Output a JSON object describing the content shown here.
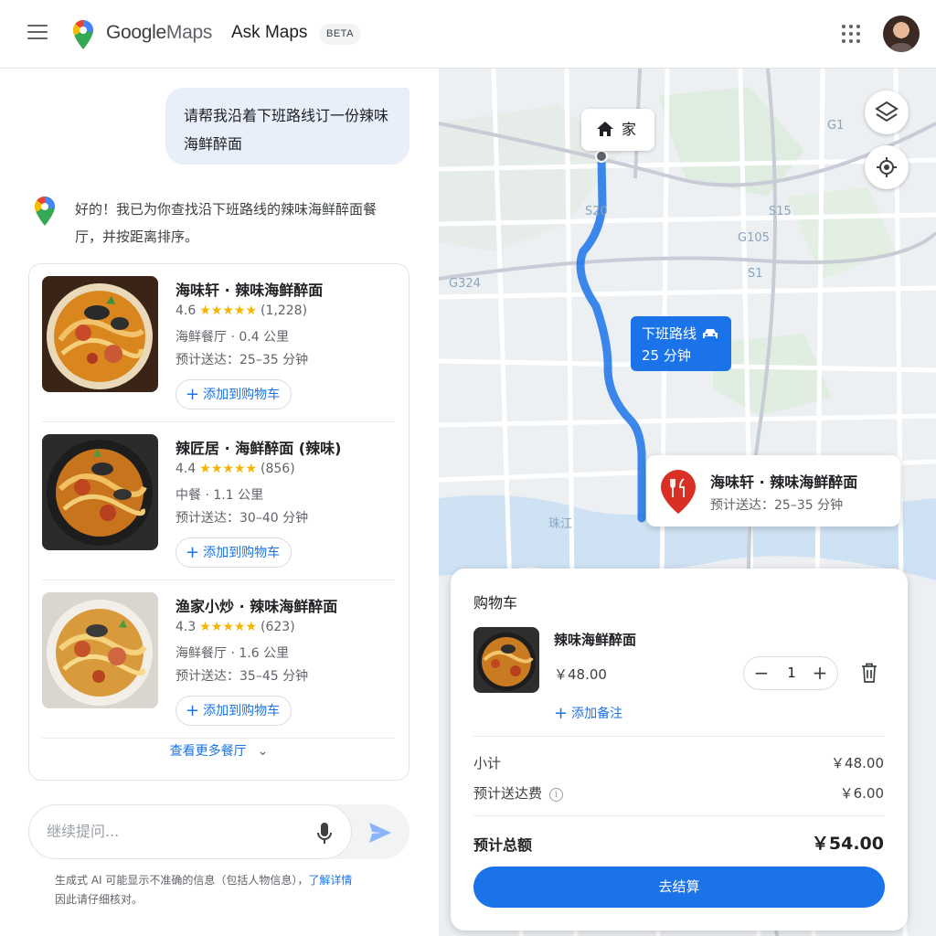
{
  "header": {
    "logo_google": "Google",
    "logo_maps": "Maps",
    "title": "Ask Maps",
    "badge": "BETA"
  },
  "chat": {
    "user_message": "请帮我沿着下班路线订一份辣味海鲜醉面",
    "ai_message": "好的！我已为你查找沿下班路线的辣味海鲜醉面餐厅，并按距离排序。"
  },
  "results": [
    {
      "name": "海味轩 · 辣味海鲜醉面",
      "rating": "4.6",
      "stars": 4.6,
      "reviews": "(1,228)",
      "meta": "海鲜餐厅 · 0.4 公里",
      "eta": "预计送达：25–35 分钟",
      "add_label": "添加到购物车"
    },
    {
      "name": "辣匠居 · 海鲜醉面 (辣味)",
      "rating": "4.4",
      "stars": 4.4,
      "reviews": "(856)",
      "meta": "中餐 · 1.1 公里",
      "eta": "预计送达：30–40 分钟",
      "add_label": "添加到购物车"
    },
    {
      "name": "渔家小炒 · 辣味海鲜醉面",
      "rating": "4.3",
      "stars": 4.3,
      "reviews": "(623)",
      "meta": "海鲜餐厅 · 1.6 公里",
      "eta": "预计送达：35–45 分钟",
      "add_label": "添加到购物车"
    }
  ],
  "more_label": "查看更多餐厅",
  "input": {
    "placeholder": "继续提问..."
  },
  "disclaimer": {
    "text": "生成式 AI 可能显示不准确的信息（包括人物信息），",
    "link": "了解详情",
    "text2": "因此请仔细核对。"
  },
  "map": {
    "home_label": "家",
    "route_label": "下班路线",
    "route_time": "25 分钟",
    "dest_name": "海味轩 · 辣味海鲜醉面",
    "dest_eta": "预计送达：25–35 分钟",
    "road_labels": [
      "S20",
      "S15",
      "G105",
      "G324",
      "S1",
      "G1",
      "珠江"
    ]
  },
  "cart": {
    "title": "购物车",
    "item_name": "辣味海鲜醉面",
    "item_price": "￥48.00",
    "quantity": "1",
    "add_note": "添加备注",
    "subtotal_label": "小计",
    "subtotal_value": "￥48.00",
    "delivery_label": "预计送达费",
    "delivery_value": "￥6.00",
    "total_label": "预计总额",
    "total_value": "￥54.00",
    "checkout_label": "去结算"
  },
  "colors": {
    "accent": "#1a73e8",
    "star": "#f4b400",
    "pin_red": "#d93025"
  },
  "icons": [
    "menu-icon",
    "maps-pin-icon",
    "apps-grid-icon",
    "layers-icon",
    "locate-icon",
    "home-icon",
    "car-icon",
    "restaurant-pin-icon",
    "mic-icon",
    "send-icon",
    "trash-icon",
    "chevron-down-icon",
    "plus-icon",
    "info-icon"
  ]
}
